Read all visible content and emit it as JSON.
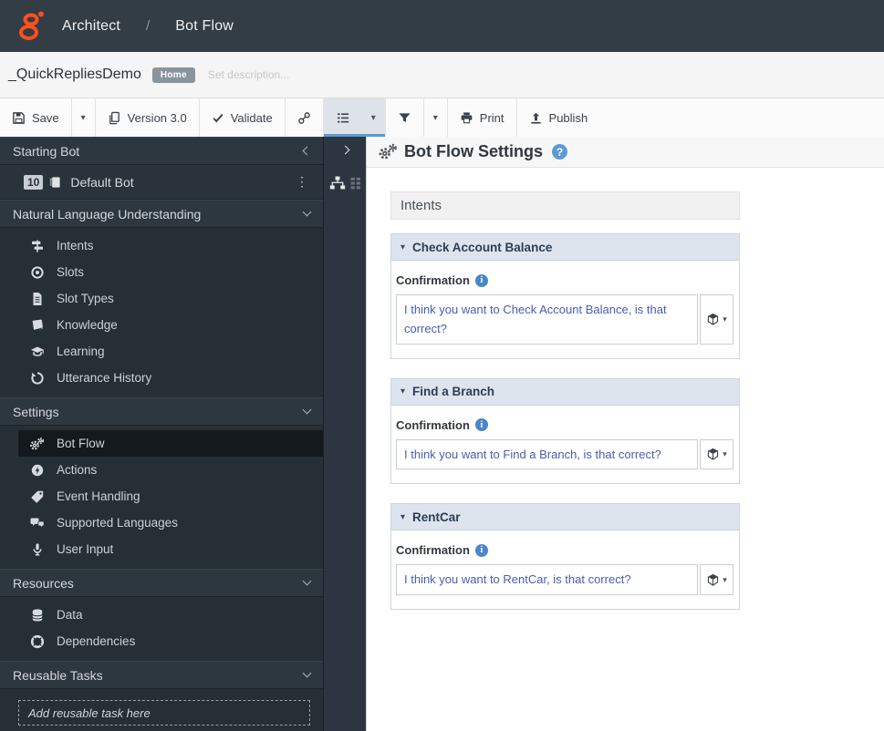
{
  "topbar": {
    "product": "Architect",
    "separator": "/",
    "page": "Bot Flow"
  },
  "titlebar": {
    "flow_name": "_QuickRepliesDemo",
    "home_badge": "Home",
    "description_placeholder": "Set description..."
  },
  "toolbar": {
    "save": "Save",
    "version": "Version 3.0",
    "validate": "Validate",
    "print": "Print",
    "publish": "Publish"
  },
  "sidebar": {
    "starting_bot": {
      "title": "Starting Bot"
    },
    "default_bot": {
      "badge": "10",
      "label": "Default Bot"
    },
    "nlu": {
      "title": "Natural Language Understanding",
      "items": [
        {
          "label": "Intents"
        },
        {
          "label": "Slots"
        },
        {
          "label": "Slot Types"
        },
        {
          "label": "Knowledge"
        },
        {
          "label": "Learning"
        },
        {
          "label": "Utterance History"
        }
      ]
    },
    "settings": {
      "title": "Settings",
      "items": [
        {
          "label": "Bot Flow"
        },
        {
          "label": "Actions"
        },
        {
          "label": "Event Handling"
        },
        {
          "label": "Supported Languages"
        },
        {
          "label": "User Input"
        }
      ]
    },
    "resources": {
      "title": "Resources",
      "items": [
        {
          "label": "Data"
        },
        {
          "label": "Dependencies"
        }
      ]
    },
    "reusable_tasks": {
      "title": "Reusable Tasks",
      "placeholder": "Add reusable task here"
    }
  },
  "main": {
    "title": "Bot Flow Settings",
    "section_title": "Intents",
    "panels": [
      {
        "title": "Check Account Balance",
        "field_label": "Confirmation",
        "value": "I think you want to Check Account Balance, is that correct?"
      },
      {
        "title": "Find a Branch",
        "field_label": "Confirmation",
        "value": "I think you want to Find a Branch, is that correct?"
      },
      {
        "title": "RentCar",
        "field_label": "Confirmation",
        "value": "I think you want to RentCar, is that correct?"
      }
    ]
  },
  "colors": {
    "brand_orange": "#ff4f1f",
    "topbar_bg": "#333d45",
    "sidebar_bg": "#262f36",
    "accent_blue": "#5b9bd5",
    "panel_header_bg": "#dde4ee",
    "expression_text_blue": "#4a5cb4",
    "info_icon_blue": "#4a86c9"
  },
  "icons": {
    "logo-icon": "genesys-spiral",
    "save-icon": "floppy-disk",
    "version-icon": "copy-pages",
    "validate-icon": "checkmark",
    "link-icon": "chain-link",
    "sequence-icon": "ordered-list",
    "filter-icon": "funnel",
    "print-icon": "printer",
    "publish-icon": "upload-arrow",
    "collapse-icon": "chevron-left",
    "expand-icon": "chevron-right",
    "section-chevron-icon": "chevron-down",
    "bot-icon": "chip",
    "menu-icon": "kebab-dots",
    "hierarchy-icon": "org-tree",
    "grid-icon": "detail-grid",
    "intents-icon": "signpost",
    "slots-icon": "circle-dot",
    "slot-types-icon": "document",
    "knowledge-icon": "book",
    "learning-icon": "graduation-cap",
    "utterance-history-icon": "history-arrow",
    "bot-flow-icon": "gears",
    "actions-icon": "lightning-circle",
    "event-handling-icon": "tag",
    "supported-languages-icon": "speech-bubbles",
    "user-input-icon": "microphone",
    "data-icon": "database",
    "dependencies-icon": "life-ring",
    "help-icon": "question-circle",
    "info-icon": "info-circle",
    "expression-icon": "cube",
    "caret_glyph": "▾",
    "kebab_glyph": "⋮",
    "help_glyph": "?",
    "info_glyph": "i"
  }
}
